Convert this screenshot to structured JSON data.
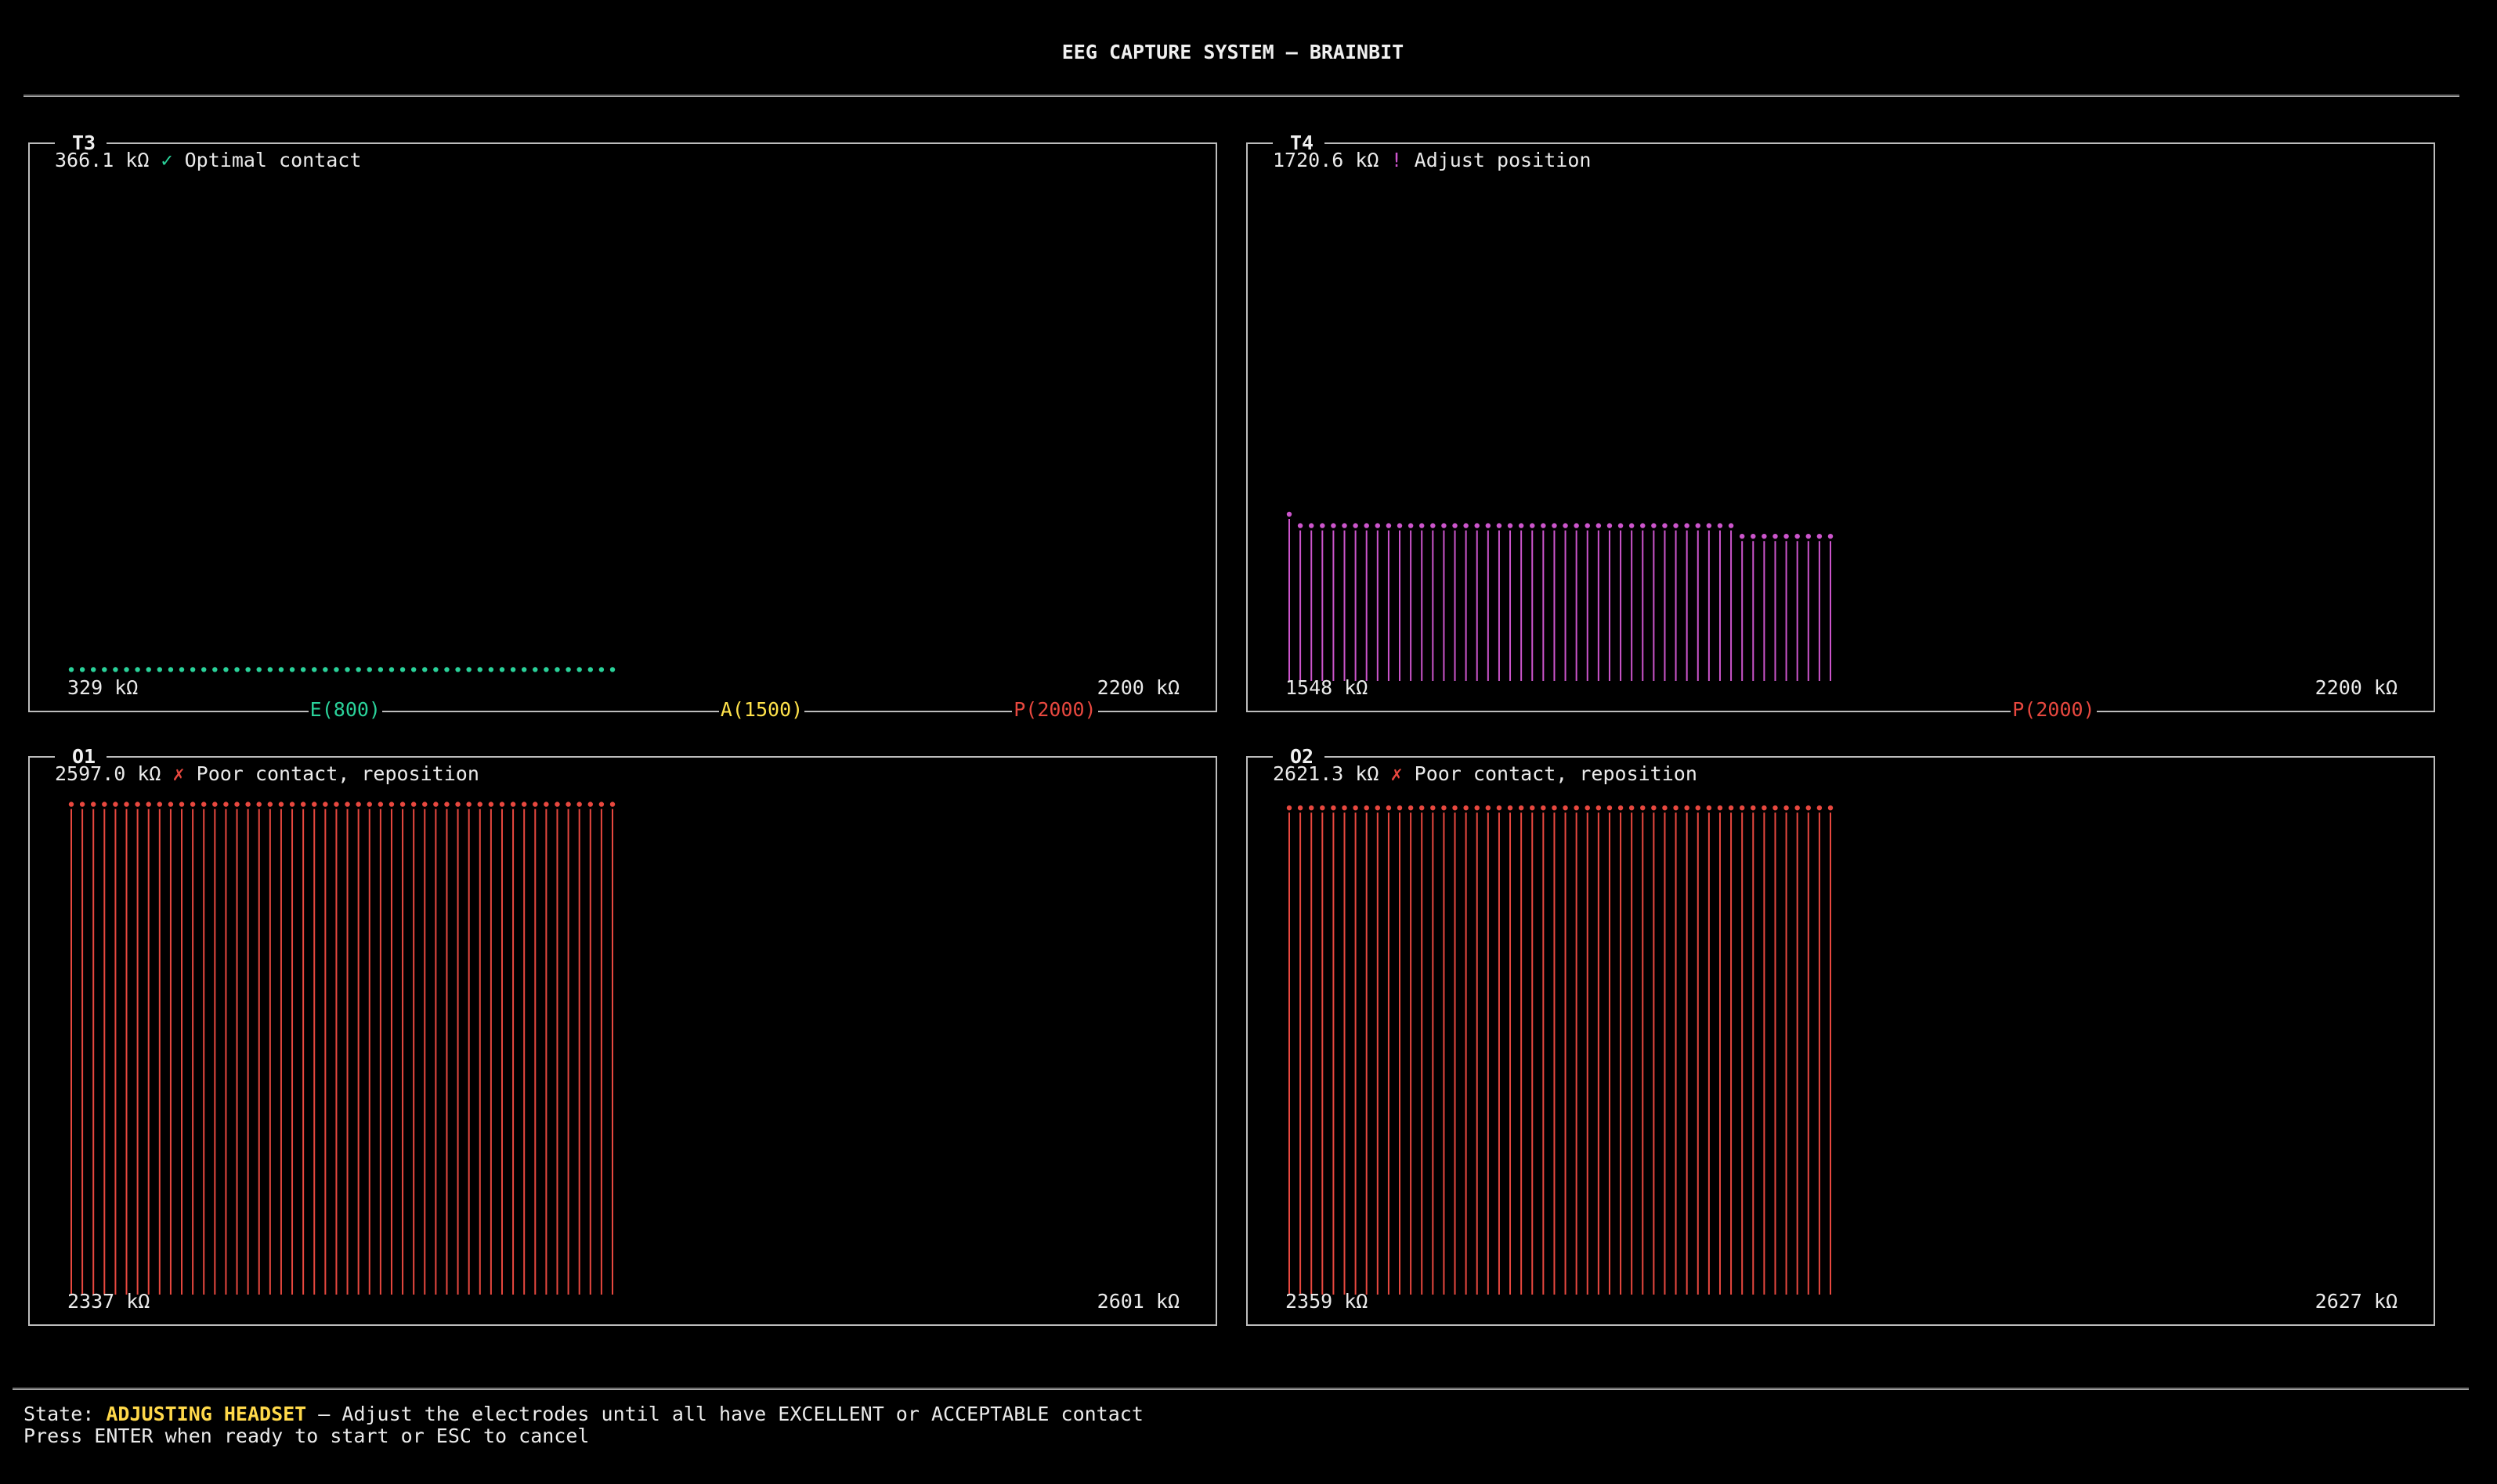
{
  "app_title": "EEG CAPTURE SYSTEM – BRAINBIT",
  "colors": {
    "excellent": "#2ad29a",
    "acceptable": "#ffe24a",
    "poor": "#e8483f",
    "adjust": "#cc55cc",
    "border": "#bdbdbd"
  },
  "panels": [
    {
      "channel": "T3",
      "impedance": "366.1 kΩ",
      "icon": "✓",
      "icon_name": "check-icon",
      "message": "Optimal contact",
      "status_color": "#2ad29a",
      "min_label": "329 kΩ",
      "max_label": "2200 kΩ",
      "range": [
        329,
        2200
      ],
      "series": [
        366,
        366,
        366,
        366,
        366,
        366,
        366,
        366,
        366,
        366,
        366,
        366,
        366,
        366,
        366,
        366,
        366,
        366,
        366,
        366,
        366,
        366,
        366,
        366,
        366,
        366,
        366,
        366,
        366,
        366,
        366,
        366,
        366,
        366,
        366,
        366,
        366,
        366,
        366,
        366,
        366,
        366,
        366,
        366,
        366,
        366,
        366,
        366,
        366,
        366
      ],
      "draw_stems": false,
      "thresholds": [
        {
          "label": "E(800)",
          "value": 800,
          "color": "#2ad29a"
        },
        {
          "label": "A(1500)",
          "value": 1500,
          "color": "#ffe24a"
        },
        {
          "label": "P(2000)",
          "value": 2000,
          "color": "#e8483f"
        }
      ]
    },
    {
      "channel": "T4",
      "impedance": "1720.6 kΩ",
      "icon": "!",
      "icon_name": "warning-icon",
      "message": "Adjust position",
      "status_color": "#cc55cc",
      "min_label": "1548 kΩ",
      "max_label": "2200 kΩ",
      "range": [
        1548,
        2200
      ],
      "series": [
        1765,
        1750,
        1750,
        1750,
        1750,
        1750,
        1750,
        1750,
        1750,
        1750,
        1750,
        1750,
        1750,
        1750,
        1750,
        1750,
        1750,
        1750,
        1750,
        1750,
        1750,
        1750,
        1750,
        1750,
        1750,
        1750,
        1750,
        1750,
        1750,
        1750,
        1750,
        1750,
        1750,
        1750,
        1750,
        1750,
        1750,
        1750,
        1750,
        1750,
        1750,
        1736,
        1736,
        1736,
        1736,
        1736,
        1736,
        1736,
        1736,
        1736
      ],
      "draw_stems": true,
      "thresholds": [
        {
          "label": "P(2000)",
          "value": 2000,
          "color": "#e8483f"
        }
      ]
    },
    {
      "channel": "O1",
      "impedance": "2597.0 kΩ",
      "icon": "✗",
      "icon_name": "cross-icon",
      "message": "Poor contact, reposition",
      "status_color": "#e8483f",
      "min_label": "2337 kΩ",
      "max_label": "2601 kΩ",
      "range": [
        2337,
        2601
      ],
      "series": [
        2597,
        2597,
        2597,
        2597,
        2597,
        2597,
        2597,
        2597,
        2597,
        2597,
        2597,
        2597,
        2597,
        2597,
        2597,
        2597,
        2597,
        2597,
        2597,
        2597,
        2597,
        2597,
        2597,
        2597,
        2597,
        2597,
        2597,
        2597,
        2597,
        2597,
        2597,
        2597,
        2597,
        2597,
        2597,
        2597,
        2597,
        2597,
        2597,
        2597,
        2597,
        2597,
        2597,
        2597,
        2597,
        2597,
        2597,
        2597,
        2597,
        2597
      ],
      "draw_stems": true,
      "thresholds": []
    },
    {
      "channel": "O2",
      "impedance": "2621.3 kΩ",
      "icon": "✗",
      "icon_name": "cross-icon",
      "message": "Poor contact, reposition",
      "status_color": "#e8483f",
      "min_label": "2359 kΩ",
      "max_label": "2627 kΩ",
      "range": [
        2359,
        2627
      ],
      "series": [
        2621,
        2621,
        2621,
        2621,
        2621,
        2621,
        2621,
        2621,
        2621,
        2621,
        2621,
        2621,
        2621,
        2621,
        2621,
        2621,
        2621,
        2621,
        2621,
        2621,
        2621,
        2621,
        2621,
        2621,
        2621,
        2621,
        2621,
        2621,
        2621,
        2621,
        2621,
        2621,
        2621,
        2621,
        2621,
        2621,
        2621,
        2621,
        2621,
        2621,
        2621,
        2621,
        2621,
        2621,
        2621,
        2621,
        2621,
        2621,
        2621,
        2621
      ],
      "draw_stems": true,
      "thresholds": []
    }
  ],
  "footer": {
    "state_label": "State: ",
    "state_value": "ADJUSTING HEADSET",
    "state_desc": " – Adjust the electrodes until all have EXCELLENT or ACCEPTABLE contact",
    "hint": "Press ENTER when ready to start or ESC to cancel"
  }
}
